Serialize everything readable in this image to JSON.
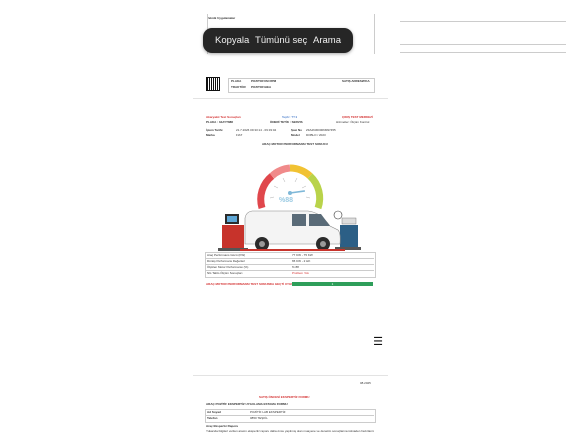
{
  "context_menu": {
    "copy": "Kopyala",
    "select_all": "Tümünü seç",
    "search": "Arama"
  },
  "page1": {
    "top_label": "Teknik Uygulamalar",
    "plate_label": "PLAKA",
    "plate_value": "POZITOFUM RPM",
    "tractor_label": "TRAKTÖR",
    "tractor_value": "POZITOF/HEA",
    "company_label": "SATIŞ ADRESI/FKA"
  },
  "report": {
    "header_left_1": "Akaryakıt Test Sonuçları",
    "header_left_2": "PLAKA : 34AYT888",
    "header_mid_1": "TeşKr: TT.3",
    "header_mid_2": "ÖNERİ TETİK : SERVIS",
    "header_right_1": "ÇIKIŞ TEST MERKEZİ",
    "header_right_2": "Hizmetler: Ölçüm Kontrol",
    "date_label": "İşlem Tarihi",
    "date_value": "21.7.2026 09:33:14 - 09:33:04",
    "brand_label": "Marka",
    "brand_value": "FIAT",
    "serial_label": "Şasi No",
    "serial_value": "ZFA26300006M97455",
    "model_label": "Model",
    "model_value": "DOBLO / 2023",
    "chart_title": "ARAÇ MOTOR PERFORMANSI TEST SONUCU",
    "gauge_value": "%88",
    "row1_label": "Araç Performans Gücü (KW)",
    "row1_value": "77 KW - 75 KW",
    "row2_label": "Dönüş Performans Değerleri",
    "row2_value": "65 KW - 2 HK",
    "row3_label": "Ölçülen Motor Performansı (%)",
    "row3_value": "% 88",
    "row4_label": "NG Tablo Ölçüm Sonuçları",
    "row4_value": "Problem Yok",
    "result_label": "ARAÇ MOTOR PERFORMANSI TEST SONUNDA GEÇTİ UYGUNDUR",
    "result_value": "1"
  },
  "page3": {
    "date": "08.2025",
    "title": "SATIŞ ÖNCESİ EKSPERTİZ FORMU",
    "subtitle": "ARAÇ POZİTİF EKSPERTİZ UYGULAMA ESTAMA FORMU",
    "row1_label": "Ad Soyad",
    "row1_value": "POZİTİF LAB EKSPERTİZ",
    "row2_label": "Telefon",
    "row2_value": "0850 TEŞKİL",
    "note_title": "Araç Ekspertiz Raporu",
    "note_text": "Yukarıda bilgileri verilen aracın ekspertiz raporu daha önce yapılmış olan muayene ve denetim sonuçlarına istinaden hazırlanmıştır. Başvuru ile ilgili bilgiler Ekspertiz ve Satış Formunda belirtilmektedir."
  },
  "colors": {
    "menu_bg": "#262626",
    "menu_text": "#f2f2f2",
    "accent_red": "#d32f2f",
    "accent_blue": "#1f5fbf",
    "result_green": "#2e9e5a"
  },
  "icons": {
    "menu": "hamburger-menu-icon",
    "qr": "qr-code-icon"
  },
  "gauge": {
    "value_percent": 88
  }
}
